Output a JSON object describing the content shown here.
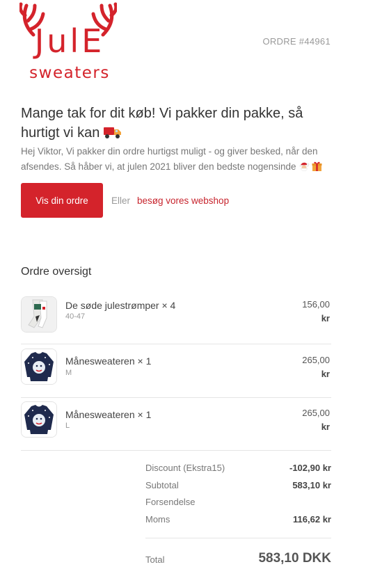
{
  "header": {
    "logo_text_top": "JulE",
    "logo_text_bottom": "sweaters",
    "order_number": "ORDRE #44961",
    "brand_color": "#d4232b"
  },
  "main": {
    "headline": "Mange tak for dit køb! Vi pakker din pakke, så hurtigt vi kan",
    "intro": "Hej Viktor, Vi pakker din ordre hurtigst muligt - og giver besked, når den afsendes. Så håber vi, at julen 2021 bliver den bedste nogensinde",
    "cta_label": "Vis din ordre",
    "or_label": "Eller",
    "shop_link_label": "besøg vores webshop"
  },
  "summary": {
    "title": "Ordre oversigt",
    "items": [
      {
        "name": "De søde julestrømper × 4",
        "variant": "40-47",
        "amount": "156,00",
        "currency": "kr",
        "image": "socks-icon"
      },
      {
        "name": "Månesweateren × 1",
        "variant": "M",
        "amount": "265,00",
        "currency": "kr",
        "image": "sweater-icon"
      },
      {
        "name": "Månesweateren × 1",
        "variant": "L",
        "amount": "265,00",
        "currency": "kr",
        "image": "sweater-icon"
      }
    ],
    "totals": [
      {
        "label": "Discount (Ekstra15)",
        "value": "-102,90 kr"
      },
      {
        "label": "Subtotal",
        "value": "583,10 kr"
      },
      {
        "label": "Forsendelse",
        "value": ""
      },
      {
        "label": "Moms",
        "value": "116,62 kr"
      }
    ],
    "total_label": "Total",
    "total_value": "583,10 DKK"
  }
}
